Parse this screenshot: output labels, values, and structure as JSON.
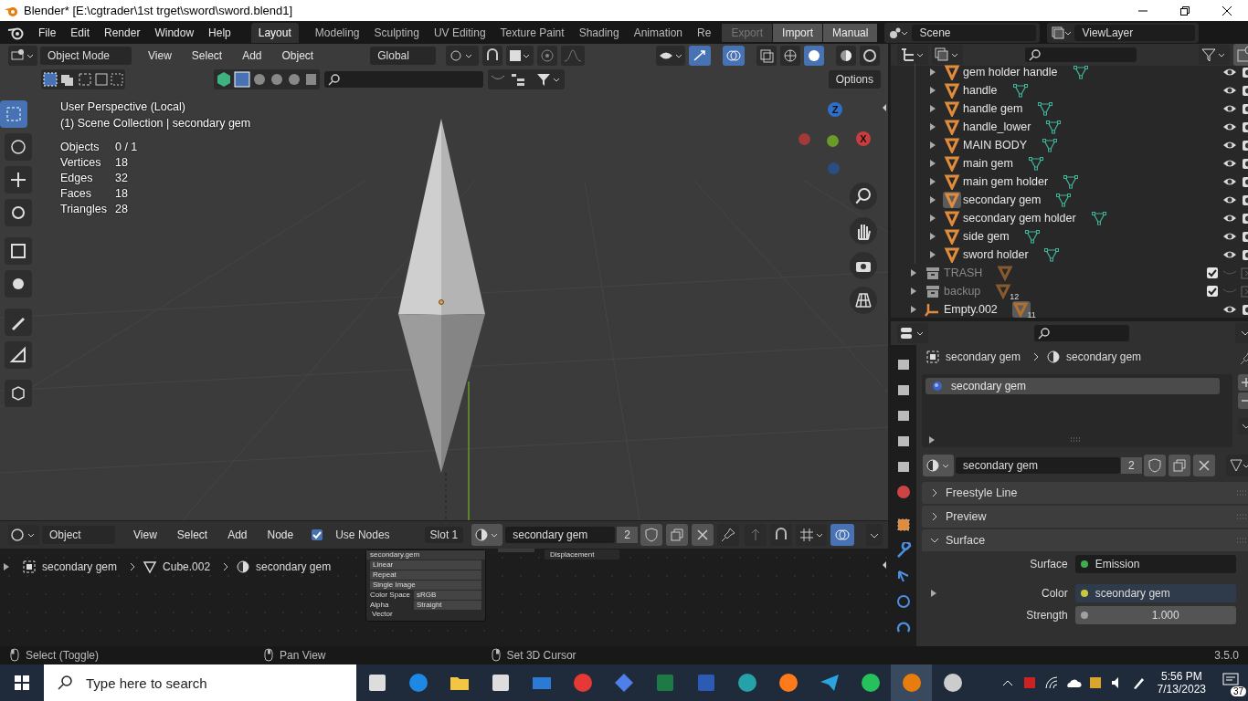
{
  "title_bar": {
    "title": "Blender* [E:\\cgtrader\\1st trget\\sword\\sword.blend1]"
  },
  "menu": [
    "File",
    "Edit",
    "Render",
    "Window",
    "Help"
  ],
  "workspaces": [
    {
      "label": "Layout",
      "selected": true
    },
    {
      "label": "Modeling",
      "selected": false
    },
    {
      "label": "Sculpting",
      "selected": false
    },
    {
      "label": "UV Editing",
      "selected": false
    },
    {
      "label": "Texture Paint",
      "selected": false
    },
    {
      "label": "Shading",
      "selected": false
    },
    {
      "label": "Animation",
      "selected": false
    },
    {
      "label": "Re",
      "selected": false
    }
  ],
  "top_buttons": [
    {
      "label": "Export",
      "disabled": true
    },
    {
      "label": "Import",
      "disabled": false
    },
    {
      "label": "Manual",
      "disabled": false
    }
  ],
  "scene": "Scene",
  "view_layer": "ViewLayer",
  "viewport": {
    "mode": "Object Mode",
    "menu": [
      "View",
      "Select",
      "Add",
      "Object"
    ],
    "orientation": "Global",
    "options": "Options",
    "overlay_title": "User Perspective (Local)",
    "overlay_sub": "(1) Scene Collection | secondary gem",
    "stats": [
      {
        "label": "Objects",
        "value": "0 / 1"
      },
      {
        "label": "Vertices",
        "value": "18"
      },
      {
        "label": "Edges",
        "value": "32"
      },
      {
        "label": "Faces",
        "value": "18"
      },
      {
        "label": "Triangles",
        "value": "28"
      }
    ],
    "tools": [
      {
        "selected": true
      },
      {
        "selected": false
      },
      {
        "selected": false
      },
      {
        "selected": false
      },
      {
        "selected": false
      },
      {
        "selected": false
      },
      {
        "selected": false
      },
      {
        "selected": false
      },
      {
        "selected": false
      }
    ],
    "gizmo": {
      "z": "Z",
      "x": "X"
    }
  },
  "node_editor": {
    "type": "Object",
    "menu": [
      "View",
      "Select",
      "Add",
      "Node"
    ],
    "use_nodes": {
      "label": "Use Nodes",
      "checked": true
    },
    "slot": "Slot 1",
    "material": "secondary gem",
    "users": "2",
    "breadcrumb": [
      "secondary gem",
      "Cube.002",
      "secondary gem"
    ],
    "node": {
      "title": "secondary.gem",
      "rows": [
        {
          "label": "Linear"
        },
        {
          "label": "Repeat"
        },
        {
          "label": "Single Image"
        },
        {
          "label": "Color Space",
          "value": "sRGB"
        },
        {
          "label": "Alpha",
          "value": "Straight"
        }
      ],
      "socket": "Vector"
    },
    "output_node": "Displacement"
  },
  "outliner": {
    "rows": [
      {
        "kind": "mesh",
        "name": "gem holder handle",
        "selected": false
      },
      {
        "kind": "mesh",
        "name": "handle",
        "selected": false
      },
      {
        "kind": "mesh",
        "name": "handle gem",
        "selected": false
      },
      {
        "kind": "mesh",
        "name": "handle_lower",
        "selected": false
      },
      {
        "kind": "mesh",
        "name": "MAIN BODY",
        "selected": false
      },
      {
        "kind": "mesh",
        "name": "main gem",
        "selected": false
      },
      {
        "kind": "mesh",
        "name": "main gem holder",
        "selected": false
      },
      {
        "kind": "mesh",
        "name": "secondary gem",
        "selected": true
      },
      {
        "kind": "mesh",
        "name": "secondary gem holder",
        "selected": false
      },
      {
        "kind": "mesh",
        "name": "side gem",
        "selected": false
      },
      {
        "kind": "mesh",
        "name": "sword holder",
        "selected": false
      },
      {
        "kind": "collection",
        "name": "TRASH",
        "checked": true,
        "disabled": true
      },
      {
        "kind": "collection",
        "name": "backup",
        "checked": true,
        "disabled": true,
        "badge": "12"
      },
      {
        "kind": "empty",
        "name": "Empty.002",
        "selected": false,
        "badge": "11"
      }
    ]
  },
  "properties": {
    "breadcrumb": [
      "secondary gem",
      "secondary gem"
    ],
    "slots": [
      {
        "label": "secondary gem",
        "selected": true
      }
    ],
    "material": "secondary gem",
    "users": "2",
    "panels": [
      {
        "label": "Freestyle Line",
        "expanded": false
      },
      {
        "label": "Preview",
        "expanded": false
      },
      {
        "label": "Surface",
        "expanded": true
      }
    ],
    "fields": [
      {
        "label": "Surface",
        "value": "Emission",
        "color": "#3fae4e"
      },
      {
        "label": "Color",
        "value": "sceondary gem",
        "color": "#c8c83c"
      },
      {
        "label": "Strength",
        "value": "1.000",
        "color": "#a0a0a0"
      }
    ]
  },
  "status_bar": {
    "hints": [
      "Select (Toggle)",
      "Pan View",
      "Set 3D Cursor"
    ],
    "version": "3.5.0"
  },
  "taskbar": {
    "search_placeholder": "Type here to search",
    "time": "5:56 PM",
    "date": "7/13/2023",
    "notifications": "37"
  }
}
